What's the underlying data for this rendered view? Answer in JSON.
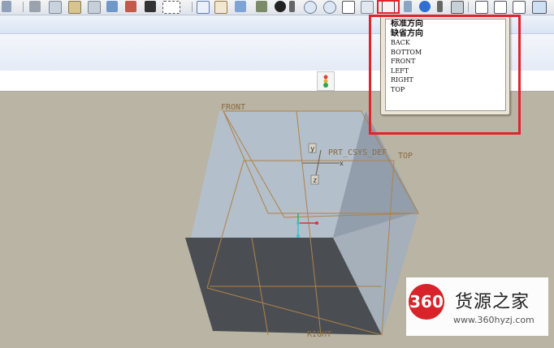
{
  "view_dropdown": {
    "items": [
      {
        "label": "标准方向",
        "kind": "cn"
      },
      {
        "label": "缺省方向",
        "kind": "cn"
      },
      {
        "label": "BACK",
        "kind": "en"
      },
      {
        "label": "BOTTOM",
        "kind": "en"
      },
      {
        "label": "FRONT",
        "kind": "en"
      },
      {
        "label": "LEFT",
        "kind": "en"
      },
      {
        "label": "RIGHT",
        "kind": "en"
      },
      {
        "label": "TOP",
        "kind": "en"
      }
    ]
  },
  "model": {
    "datum_front": "FRONT",
    "datum_top": "TOP",
    "datum_right": "RIGHT",
    "csys_label": "PRT_CSYS_DEF",
    "axis_x": "x",
    "axis_y": "y",
    "axis_z": "z"
  },
  "colors": {
    "highlight": "#e0242a",
    "datum_line": "#b0824a",
    "face_top": "#b3bfca",
    "face_dark": "#4a4e52",
    "face_side": "#8f9aa6",
    "background": "#b9b4a4"
  },
  "watermark": {
    "badge": "360",
    "name": "货源之家",
    "url": "www.360hyzj.com"
  }
}
